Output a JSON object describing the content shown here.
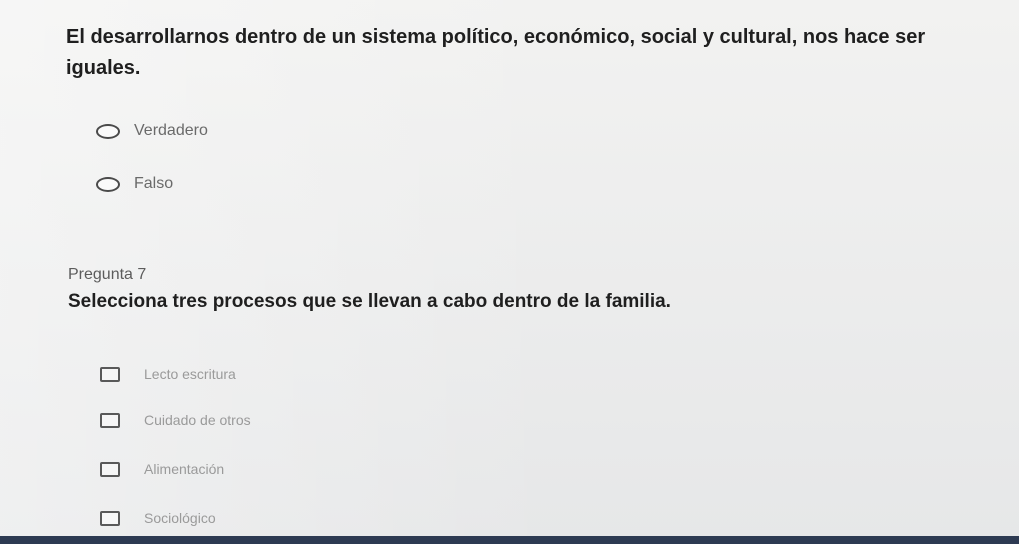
{
  "question6": {
    "text": "El desarrollarnos dentro de un sistema político, económico, social y cultural, nos hace ser iguales.",
    "options": [
      {
        "label": "Verdadero",
        "selected": false
      },
      {
        "label": "Falso",
        "selected": false
      }
    ]
  },
  "question7": {
    "number_label": "Pregunta 7",
    "text": "Selecciona tres procesos que se llevan a cabo dentro de la familia.",
    "options": [
      {
        "label": "Lecto escritura",
        "checked": false
      },
      {
        "label": "Cuidado de otros",
        "checked": false
      },
      {
        "label": "Alimentación",
        "checked": false
      },
      {
        "label": "Sociológico",
        "checked": false
      }
    ]
  },
  "colors": {
    "background": "#e9eaea",
    "text": "#1f1f1f",
    "taskbar": "#2d3a52"
  }
}
